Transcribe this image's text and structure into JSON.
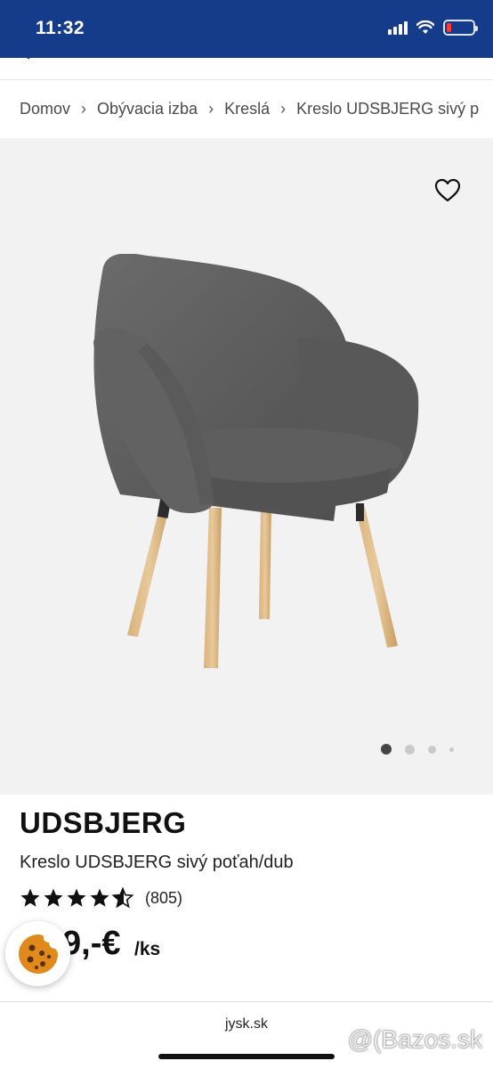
{
  "status_bar": {
    "time": "11:32"
  },
  "breadcrumb": {
    "items": [
      "Domov",
      "Obývacia izba",
      "Kreslá",
      "Kreslo UDSBJERG sivý p"
    ]
  },
  "product": {
    "brand": "UDSBJERG",
    "name": "Kreslo UDSBJERG sivý poťah/dub",
    "rating_stars": 4.5,
    "rating_count": "(805)",
    "price": "9,-€",
    "price_unit": "/ks"
  },
  "gallery": {
    "slide_count": 4,
    "active_slide": 1
  },
  "browser": {
    "url": "jysk.sk"
  },
  "watermark": "Bazos.sk",
  "colors": {
    "header_blue": "#143c8a",
    "gallery_bg": "#f2f2f2",
    "star": "#111111"
  }
}
